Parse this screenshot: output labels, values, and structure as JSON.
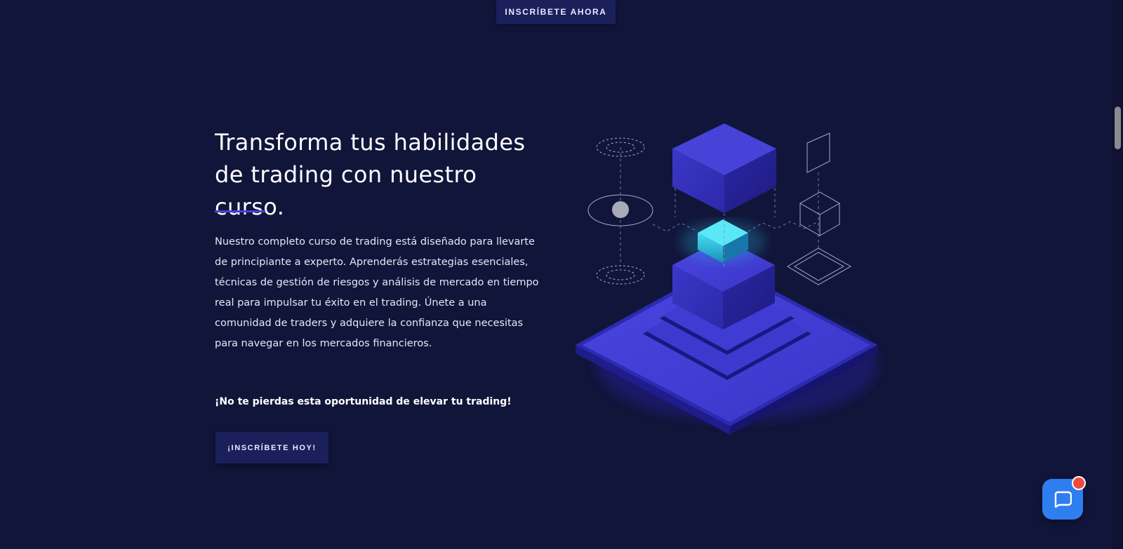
{
  "top_cta": {
    "label": "INSCRÍBETE AHORA"
  },
  "hero": {
    "title": "Transforma tus habilidades de trading con nuestro curso.",
    "description": "Nuestro completo curso de trading está diseñado para llevarte de principiante a experto. Aprenderás estrategias esenciales, técnicas de gestión de riesgos y análisis de mercado en tiempo real para impulsar tu éxito en el trading. Únete a una comunidad de traders y adquiere la confianza que necesitas para navegar en los mercados financieros.",
    "tagline": "¡No te pierdas esta oportunidad de elevar tu trading!",
    "cta_label": "¡INSCRÍBETE HOY!"
  },
  "colors": {
    "background": "#11153a",
    "button": "#1b1f5a",
    "accent": "#4b3ed8",
    "cube": "#3a36c9",
    "glow_cube": "#2bc6e0",
    "chat": "#2f7ef0",
    "badge": "#f0493c"
  },
  "icons": {
    "illustration": "isometric-cubes-illustration",
    "chat": "chat-bubble-icon"
  }
}
